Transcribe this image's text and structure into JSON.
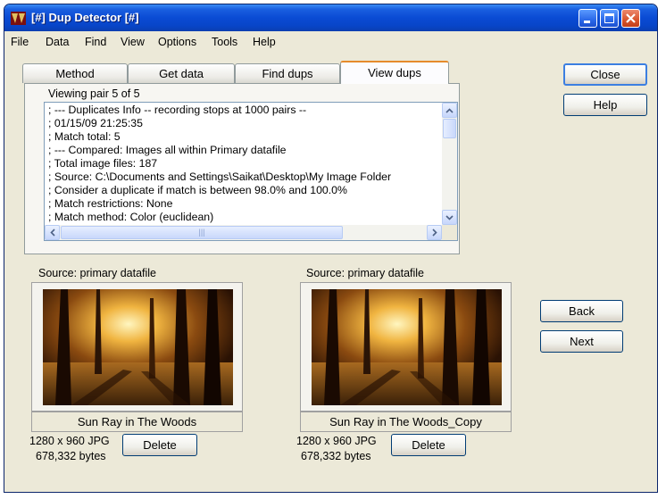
{
  "window": {
    "title": "[#] Dup Detector [#]"
  },
  "menu": [
    "File",
    "Data",
    "Find",
    "View",
    "Options",
    "Tools",
    "Help"
  ],
  "tabs": [
    {
      "label": "Method",
      "active": false
    },
    {
      "label": "Get data",
      "active": false
    },
    {
      "label": "Find dups",
      "active": false
    },
    {
      "label": "View dups",
      "active": true
    }
  ],
  "viewing": "Viewing pair 5 of 5",
  "log": [
    "; --- Duplicates Info -- recording stops at 1000 pairs --",
    "; 01/15/09 21:25:35",
    "; Match total: 5",
    "; --- Compared: Images all within Primary datafile",
    "; Total image files: 187",
    "; Source: C:\\Documents and Settings\\Saikat\\Desktop\\My Image Folder",
    "; Consider a duplicate if match is between 98.0% and 100.0%",
    "; Match restrictions: None",
    "; Match method: Color (euclidean)"
  ],
  "buttons": {
    "close": "Close",
    "help": "Help",
    "back": "Back",
    "next": "Next",
    "delete": "Delete"
  },
  "left_image": {
    "source": "Source: primary datafile",
    "name": "Sun Ray in The Woods",
    "dims": "1280 x 960 JPG",
    "size": "678,332 bytes"
  },
  "right_image": {
    "source": "Source: primary datafile",
    "name": "Sun Ray in The Woods_Copy",
    "dims": "1280 x 960 JPG",
    "size": "678,332 bytes"
  },
  "colors": {
    "title_blue": "#0a4bd4",
    "window_bg": "#ece9d8",
    "active_tab_accent": "#e68b2c"
  }
}
